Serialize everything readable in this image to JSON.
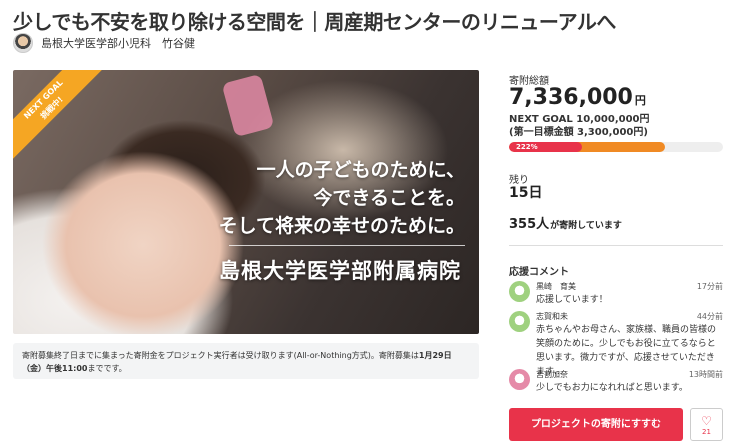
{
  "page": {
    "title": "少しでも不安を取り除ける空間を｜周産期センターのリニューアルへ",
    "author": "島根大学医学部小児科　竹谷健"
  },
  "hero": {
    "ribbon_line1": "NEXT GOAL",
    "ribbon_line2": "挑戦中!",
    "line1": "一人の子どものために、",
    "line2": "今できることを。",
    "line3": "そして将来の幸せのために。",
    "hospital": "島根大学医学部附属病院"
  },
  "notice": {
    "text_before": "寄附募集終了日までに集まった寄附金をプロジェクト実行者は受け取ります(All-or-Nothing方式)。寄附募集は",
    "text_bold": "1月29日（金）午後11:00",
    "text_after": "までです。"
  },
  "stats": {
    "total_label": "寄附総額",
    "amount": "7,336,000",
    "currency": "円",
    "next_goal": "NEXT GOAL 10,000,000円",
    "first_goal": "(第一目標金額 3,300,000円)",
    "percent_text": "222%",
    "progress_to_next_goal": 0.73,
    "remaining_label": "残り",
    "remaining_value": "15日",
    "supporters_count": "355人",
    "supporters_suffix": "が寄附しています"
  },
  "comments": {
    "heading": "応援コメント",
    "items": [
      {
        "name": "黒崎　育美",
        "time": "17分前",
        "text": "応援しています！",
        "avatar_color": "#9fd17f"
      },
      {
        "name": "志賀和未",
        "time": "44分前",
        "text": "赤ちゃんやお母さん、家族様、職員の皆様の笑顔のために。少しでもお役に立てるならと思います。微力ですが、応援させていただきます...",
        "avatar_color": "#9fd17f"
      },
      {
        "name": "吉割加奈",
        "time": "13時間前",
        "text": "少しでもお力になれればと思います。",
        "avatar_color": "#e58aa8"
      }
    ]
  },
  "actions": {
    "donate_label": "プロジェクトの寄附にすすむ",
    "favorite_icon": "heart-icon",
    "favorite_count": "21"
  },
  "colors": {
    "accent": "#e8334a",
    "progress": "#f08a24",
    "ribbon": "#f5a623"
  }
}
